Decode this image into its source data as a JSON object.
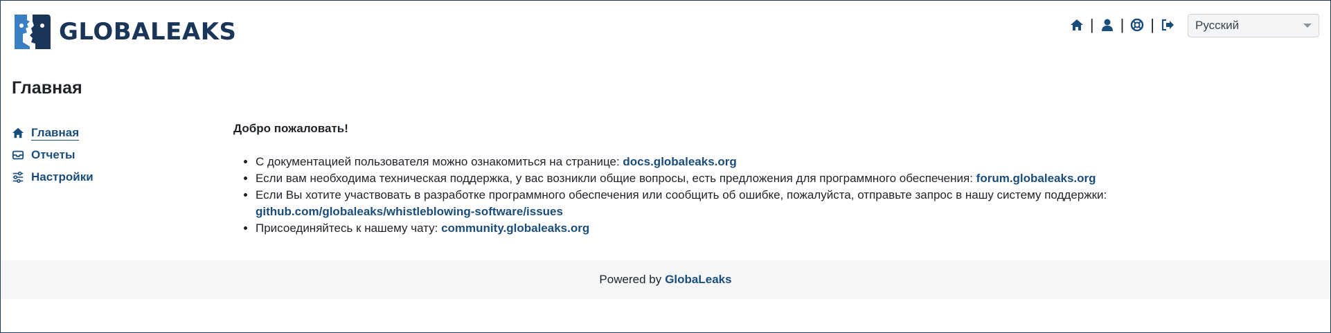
{
  "brand": {
    "name": "GLOBALEAKS",
    "primary_color": "#1a3558",
    "accent_color": "#3a7fc1"
  },
  "header": {
    "nav_icons": [
      "home-icon",
      "user-icon",
      "help-icon",
      "logout-icon"
    ],
    "language_selected": "Русский"
  },
  "page": {
    "title": "Главная"
  },
  "sidebar": {
    "items": [
      {
        "label": "Главная",
        "icon": "home-icon",
        "active": true
      },
      {
        "label": "Отчеты",
        "icon": "inbox-icon",
        "active": false
      },
      {
        "label": "Настройки",
        "icon": "sliders-icon",
        "active": false
      }
    ]
  },
  "main": {
    "welcome": "Добро пожаловать!",
    "items": [
      {
        "text": "С документацией пользователя можно ознакомиться на странице: ",
        "link": "docs.globaleaks.org"
      },
      {
        "text": "Если вам необходима техническая поддержка, у вас возникли общие вопросы, есть предложения для программного обеспечения: ",
        "link": "forum.globaleaks.org"
      },
      {
        "text": "Если Вы хотите участвовать в разработке программного обеспечения или сообщить об ошибке, пожалуйста, отправьте запрос в нашу систему поддержки: ",
        "link": "github.com/globaleaks/whistleblowing-software/issues"
      },
      {
        "text": "Присоединяйтесь к нашему чату: ",
        "link": "community.globaleaks.org"
      }
    ]
  },
  "footer": {
    "prefix": "Powered by",
    "link": "GlobaLeaks"
  }
}
